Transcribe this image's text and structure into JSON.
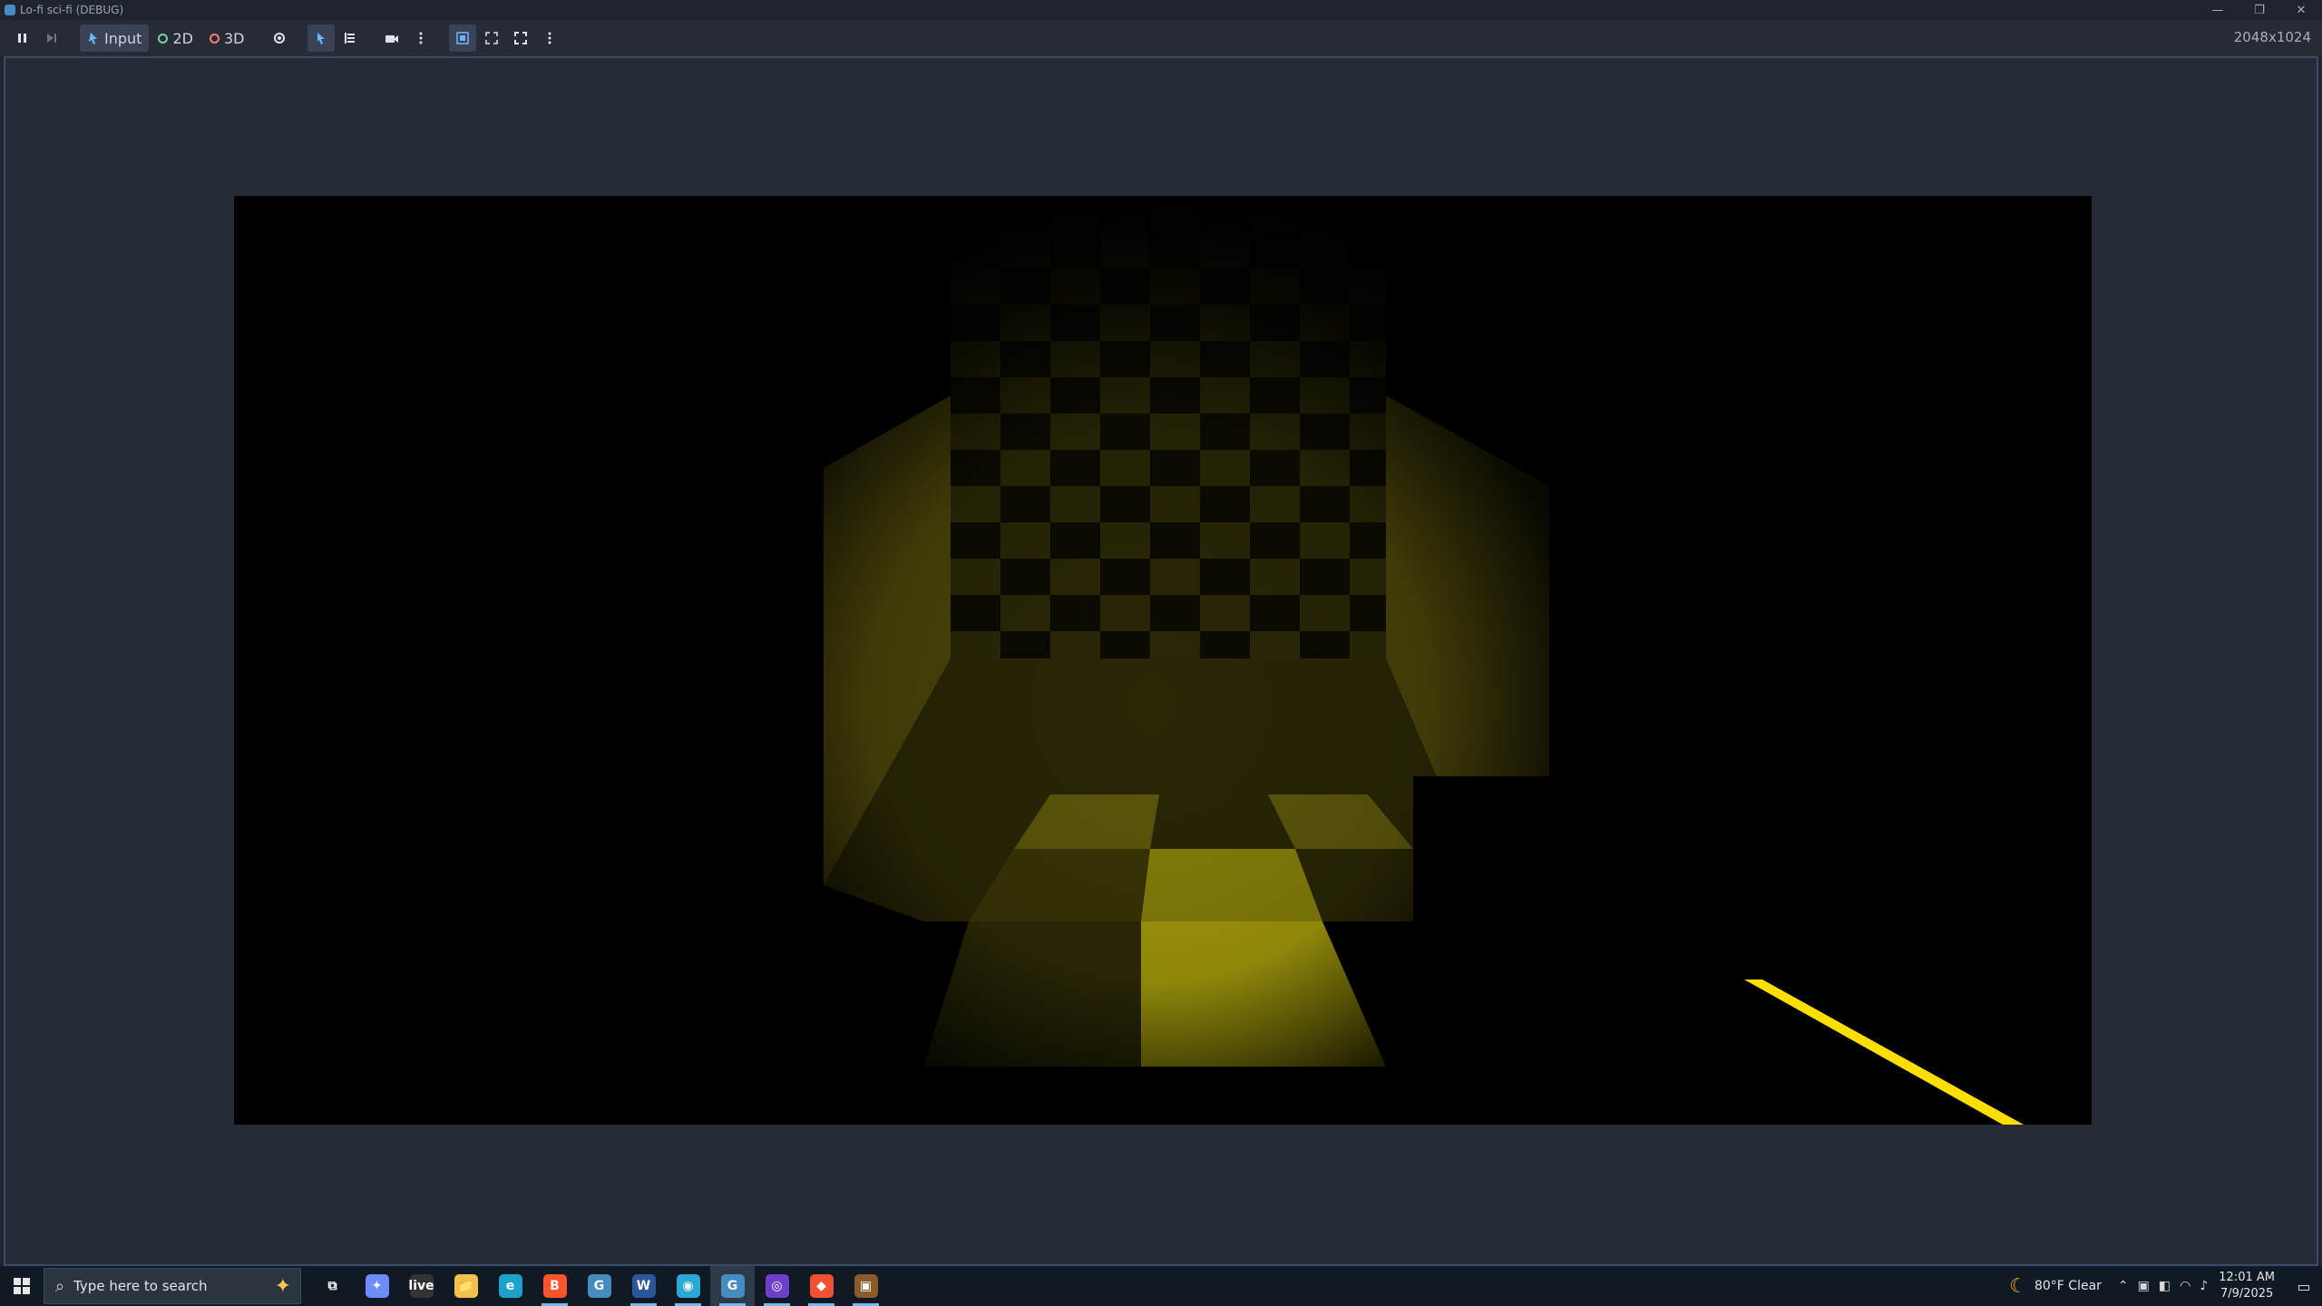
{
  "window": {
    "title": "Lo-fi sci-fi (DEBUG)",
    "minimize": "—",
    "restore": "❐",
    "close": "✕"
  },
  "toolbar": {
    "pause_icon": "pause-icon",
    "step_icon": "step-frame-icon",
    "input_label": "Input",
    "mode_2d_label": "2D",
    "mode_3d_label": "3D",
    "resolution": "2048x1024"
  },
  "game": {
    "floor_color": "#cfc30a",
    "wall_color": "#8a820a",
    "beam_color": "#ffdf00"
  },
  "taskbar": {
    "search_placeholder": "Type here to search",
    "apps": [
      {
        "name": "task-view",
        "glyph": "⧉",
        "running": false
      },
      {
        "name": "copilot",
        "glyph": "✦",
        "running": false,
        "color": "#6f8cff"
      },
      {
        "name": "live-captions",
        "glyph": "live",
        "running": false,
        "color": "#333"
      },
      {
        "name": "file-explorer",
        "glyph": "📁",
        "running": false,
        "color": "#f2c14e"
      },
      {
        "name": "edge",
        "glyph": "e",
        "running": false,
        "color": "#1da1c9"
      },
      {
        "name": "brave",
        "glyph": "B",
        "running": true,
        "color": "#fb542b"
      },
      {
        "name": "godot",
        "glyph": "G",
        "running": false,
        "color": "#478cbf"
      },
      {
        "name": "wordpad",
        "glyph": "W",
        "running": true,
        "color": "#2b579a"
      },
      {
        "name": "app-blue",
        "glyph": "◉",
        "running": true,
        "color": "#2aa9d6"
      },
      {
        "name": "godot-running",
        "glyph": "G",
        "running": true,
        "selected": true,
        "color": "#478cbf"
      },
      {
        "name": "github",
        "glyph": "◎",
        "running": true,
        "color": "#6e40c9"
      },
      {
        "name": "git",
        "glyph": "◆",
        "running": true,
        "color": "#f05033"
      },
      {
        "name": "archive",
        "glyph": "▣",
        "running": true,
        "color": "#8b5a2b"
      }
    ],
    "weather_temp": "80°F",
    "weather_desc": "Clear",
    "time": "12:01 AM",
    "date": "7/9/2025"
  }
}
